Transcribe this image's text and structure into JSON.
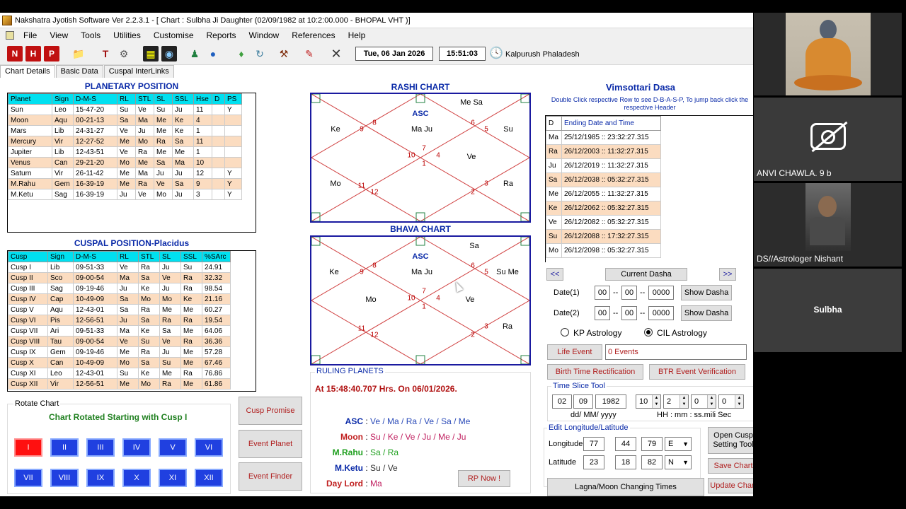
{
  "window": {
    "title": "Nakshatra Jyotish Software Ver 2.2.3.1 - [ Chart : Sulbha Ji Daughter (02/09/1982 at 10:2:00.000 - BHOPAL VHT )]"
  },
  "menu": [
    "File",
    "View",
    "Tools",
    "Utilities",
    "Customise",
    "Reports",
    "Window",
    "References",
    "Help"
  ],
  "toolbar": {
    "date": "Tue, 06 Jan 2026",
    "time": "15:51:03",
    "kalpurush": "Kalpurush Phaladesh"
  },
  "tabs": [
    "Chart Details",
    "Basic Data",
    "Cuspal InterLinks"
  ],
  "planetary": {
    "title": "PLANETARY POSITION",
    "headers": [
      "Planet",
      "Sign",
      "D-M-S",
      "RL",
      "STL",
      "SL",
      "SSL",
      "Hse",
      "D",
      "PS"
    ],
    "rows": [
      [
        "Sun",
        "Leo",
        "15-47-20",
        "Su",
        "Ve",
        "Su",
        "Ju",
        "11",
        "",
        "Y"
      ],
      [
        "Moon",
        "Aqu",
        "00-21-13",
        "Sa",
        "Ma",
        "Me",
        "Ke",
        "4",
        "",
        ""
      ],
      [
        "Mars",
        "Lib",
        "24-31-27",
        "Ve",
        "Ju",
        "Me",
        "Ke",
        "1",
        "",
        ""
      ],
      [
        "Mercury",
        "Vir",
        "12-27-52",
        "Me",
        "Mo",
        "Ra",
        "Sa",
        "11",
        "",
        ""
      ],
      [
        "Jupiter",
        "Lib",
        "12-43-51",
        "Ve",
        "Ra",
        "Me",
        "Me",
        "1",
        "",
        ""
      ],
      [
        "Venus",
        "Can",
        "29-21-20",
        "Mo",
        "Me",
        "Sa",
        "Ma",
        "10",
        "",
        ""
      ],
      [
        "Saturn",
        "Vir",
        "26-11-42",
        "Me",
        "Ma",
        "Ju",
        "Ju",
        "12",
        "",
        "Y"
      ],
      [
        "M.Rahu",
        "Gem",
        "16-39-19",
        "Me",
        "Ra",
        "Ve",
        "Sa",
        "9",
        "",
        "Y"
      ],
      [
        "M.Ketu",
        "Sag",
        "16-39-19",
        "Ju",
        "Ve",
        "Mo",
        "Ju",
        "3",
        "",
        "Y"
      ]
    ]
  },
  "cuspal": {
    "title": "CUSPAL POSITION-Placidus",
    "headers": [
      "Cusp",
      "Sign",
      "D-M-S",
      "RL",
      "STL",
      "SL",
      "SSL",
      "%SArc"
    ],
    "rows": [
      [
        "Cusp I",
        "Lib",
        "09-51-33",
        "Ve",
        "Ra",
        "Ju",
        "Su",
        "24.91"
      ],
      [
        "Cusp II",
        "Sco",
        "09-00-54",
        "Ma",
        "Sa",
        "Ve",
        "Ra",
        "32.32"
      ],
      [
        "Cusp III",
        "Sag",
        "09-19-46",
        "Ju",
        "Ke",
        "Ju",
        "Ra",
        "98.54"
      ],
      [
        "Cusp IV",
        "Cap",
        "10-49-09",
        "Sa",
        "Mo",
        "Mo",
        "Ke",
        "21.16"
      ],
      [
        "Cusp V",
        "Aqu",
        "12-43-01",
        "Sa",
        "Ra",
        "Me",
        "Me",
        "60.27"
      ],
      [
        "Cusp VI",
        "Pis",
        "12-56-51",
        "Ju",
        "Sa",
        "Ra",
        "Ra",
        "19.54"
      ],
      [
        "Cusp VII",
        "Ari",
        "09-51-33",
        "Ma",
        "Ke",
        "Sa",
        "Me",
        "64.06"
      ],
      [
        "Cusp VIII",
        "Tau",
        "09-00-54",
        "Ve",
        "Su",
        "Ve",
        "Ra",
        "36.36"
      ],
      [
        "Cusp IX",
        "Gem",
        "09-19-46",
        "Me",
        "Ra",
        "Ju",
        "Me",
        "57.28"
      ],
      [
        "Cusp X",
        "Can",
        "10-49-09",
        "Mo",
        "Sa",
        "Su",
        "Me",
        "67.46"
      ],
      [
        "Cusp XI",
        "Leo",
        "12-43-01",
        "Su",
        "Ke",
        "Me",
        "Ra",
        "76.86"
      ],
      [
        "Cusp XII",
        "Vir",
        "12-56-51",
        "Me",
        "Mo",
        "Ra",
        "Me",
        "61.86"
      ]
    ]
  },
  "rotate": {
    "title": "Rotate Chart",
    "caption": "Chart Rotated Starting with Cusp I",
    "buttons": [
      "I",
      "II",
      "III",
      "IV",
      "V",
      "VI",
      "VII",
      "VIII",
      "IX",
      "X",
      "XI",
      "XII"
    ]
  },
  "mid_buttons": {
    "cusp_promise": "Cusp Promise",
    "event_planet": "Event Planet",
    "event_finder": "Event Finder"
  },
  "rashi": {
    "title": "RASHI CHART",
    "asc": "ASC",
    "labels": [
      {
        "t": "Me Sa"
      },
      {
        "t": "Ke"
      },
      {
        "t": "Ma Ju"
      },
      {
        "t": "Su"
      },
      {
        "t": "Ve"
      },
      {
        "t": "Mo"
      },
      {
        "t": "Ra"
      }
    ],
    "nums": [
      "9",
      "8",
      "6",
      "5",
      "7",
      "10",
      "4",
      "1",
      "11",
      "3",
      "12",
      "2"
    ]
  },
  "bhava": {
    "title": "BHAVA CHART",
    "asc": "ASC",
    "labels": [
      {
        "t": "Sa"
      },
      {
        "t": "Ke"
      },
      {
        "t": "Ma Ju"
      },
      {
        "t": "Su Me"
      },
      {
        "t": "Mo"
      },
      {
        "t": "Ve"
      },
      {
        "t": "Ra"
      }
    ],
    "nums": [
      "9",
      "8",
      "6",
      "5",
      "7",
      "10",
      "4",
      "1",
      "11",
      "3",
      "12",
      "2"
    ]
  },
  "ruling": {
    "title": "RULING PLANETS",
    "at": "At 15:48:40.707 Hrs. On 06/01/2026.",
    "rows": [
      {
        "k": "ASC",
        "v": "Ve / Ma / Ra / Ve / Sa / Me",
        "kc": "#0a2aa8",
        "vc": "#2a4ab8"
      },
      {
        "k": "Moon",
        "v": "Su / Ke / Ve / Ju / Me / Ju",
        "kc": "#c02020",
        "vc": "#c02060"
      },
      {
        "k": "M.Rahu",
        "v": "Sa / Ra",
        "kc": "#20a020",
        "vc": "#20a020"
      },
      {
        "k": "M.Ketu",
        "v": "Su / Ve",
        "kc": "#0a2aa8",
        "vc": "#333333"
      },
      {
        "k": "Day Lord",
        "v": "Ma",
        "kc": "#c02020",
        "vc": "#c02060"
      }
    ],
    "rp_now": "RP Now !"
  },
  "dasa": {
    "title": "Vimsottari Dasa",
    "hint": "Double Click respective Row to see D-B-A-S-P, To jump back click the respective Header",
    "headers": [
      "D",
      "Ending Date and Time"
    ],
    "rows": [
      [
        "Ma",
        "25/12/1985 :: 23:32:27.315"
      ],
      [
        "Ra",
        "26/12/2003 :: 11:32:27.315"
      ],
      [
        "Ju",
        "26/12/2019 :: 11:32:27.315"
      ],
      [
        "Sa",
        "26/12/2038 :: 05:32:27.315"
      ],
      [
        "Me",
        "26/12/2055 :: 11:32:27.315"
      ],
      [
        "Ke",
        "26/12/2062 :: 05:32:27.315"
      ],
      [
        "Ve",
        "26/12/2082 :: 05:32:27.315"
      ],
      [
        "Su",
        "26/12/2088 :: 17:32:27.315"
      ],
      [
        "Mo",
        "26/12/2098 :: 05:32:27.315"
      ]
    ],
    "prev": "<<",
    "current": "Current Dasha",
    "next": ">>",
    "date1": "Date(1)",
    "date2": "Date(2)",
    "dd": "00",
    "mm": "00",
    "yyyy": "0000",
    "show": "Show Dasha",
    "kp": "KP Astrology",
    "cil": "CIL Astrology"
  },
  "events": {
    "life_event": "Life Event",
    "events_count": "0 Events",
    "btr": "Birth Time Rectification",
    "btr_verify": "BTR Event Verification"
  },
  "timeslice": {
    "title": "Time Slice Tool",
    "day": "02",
    "month": "09",
    "year": "1982",
    "fmt1": "dd/ MM/ yyyy",
    "h": "10",
    "m": "2",
    "s": "0",
    "ms": "0",
    "fmt2": "HH : mm : ss.mili Sec"
  },
  "lonlat": {
    "title": "Edit Longitude/Latitude",
    "lon_label": "Longitude",
    "lat_label": "Latitude",
    "lon": [
      "77",
      "44",
      "79"
    ],
    "lon_dir": "E",
    "lat": [
      "23",
      "18",
      "82"
    ],
    "lat_dir": "N"
  },
  "right_buttons": {
    "open_cusp": "Open Cusp Setting Tool",
    "save": "Save Chart",
    "update": "Update Chart",
    "lagna": "Lagna/Moon Changing Times"
  },
  "participants": [
    {
      "name": ""
    },
    {
      "name": "ANVI CHAWLA. 9 b"
    },
    {
      "name": "DS//Astrologer Nishant"
    },
    {
      "name": "Sulbha"
    }
  ]
}
